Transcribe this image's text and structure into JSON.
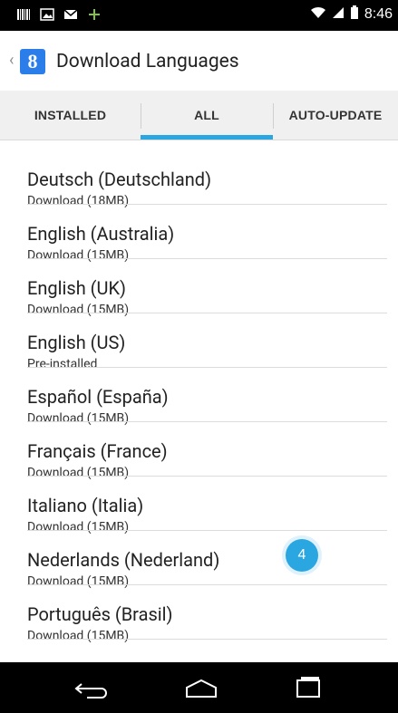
{
  "statusbar": {
    "left_icons": [
      "barcode-icon",
      "image-icon",
      "gmail-icon",
      "plus-icon"
    ],
    "time": "8:46",
    "right_icons": [
      "wifi-icon",
      "signal-icon",
      "battery-icon"
    ]
  },
  "actionbar": {
    "title": "Download Languages",
    "app_icon": "google-icon",
    "app_letter": "8"
  },
  "tabs": [
    {
      "label": "INSTALLED",
      "selected": false
    },
    {
      "label": "ALL",
      "selected": true
    },
    {
      "label": "AUTO-UPDATE",
      "selected": false
    }
  ],
  "languages": [
    {
      "name": "Deutsch (Deutschland)",
      "status": "Download (18MB)"
    },
    {
      "name": "English (Australia)",
      "status": "Download (15MB)"
    },
    {
      "name": "English (UK)",
      "status": "Download (15MB)"
    },
    {
      "name": "English (US)",
      "status": "Pre-installed"
    },
    {
      "name": "Español (España)",
      "status": "Download (15MB)"
    },
    {
      "name": "Français (France)",
      "status": "Download (15MB)"
    },
    {
      "name": "Italiano (Italia)",
      "status": "Download (15MB)"
    },
    {
      "name": "Nederlands (Nederland)",
      "status": "Download (15MB)"
    },
    {
      "name": "Português (Brasil)",
      "status": "Download (15MB)"
    }
  ],
  "badge": {
    "text": "4"
  },
  "navbar": {
    "buttons": [
      "back-icon",
      "home-icon",
      "recent-apps-icon"
    ]
  },
  "colors": {
    "accent": "#2aa6e1",
    "statusbar": "#000000",
    "tabs_bg": "#f0f0f0"
  }
}
